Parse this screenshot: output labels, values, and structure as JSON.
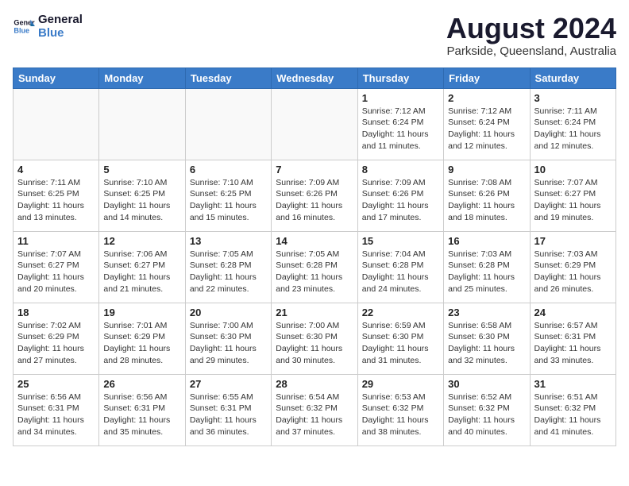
{
  "header": {
    "logo_line1": "General",
    "logo_line2": "Blue",
    "main_title": "August 2024",
    "subtitle": "Parkside, Queensland, Australia"
  },
  "weekdays": [
    "Sunday",
    "Monday",
    "Tuesday",
    "Wednesday",
    "Thursday",
    "Friday",
    "Saturday"
  ],
  "weeks": [
    [
      {
        "day": "",
        "info": ""
      },
      {
        "day": "",
        "info": ""
      },
      {
        "day": "",
        "info": ""
      },
      {
        "day": "",
        "info": ""
      },
      {
        "day": "1",
        "info": "Sunrise: 7:12 AM\nSunset: 6:24 PM\nDaylight: 11 hours\nand 11 minutes."
      },
      {
        "day": "2",
        "info": "Sunrise: 7:12 AM\nSunset: 6:24 PM\nDaylight: 11 hours\nand 12 minutes."
      },
      {
        "day": "3",
        "info": "Sunrise: 7:11 AM\nSunset: 6:24 PM\nDaylight: 11 hours\nand 12 minutes."
      }
    ],
    [
      {
        "day": "4",
        "info": "Sunrise: 7:11 AM\nSunset: 6:25 PM\nDaylight: 11 hours\nand 13 minutes."
      },
      {
        "day": "5",
        "info": "Sunrise: 7:10 AM\nSunset: 6:25 PM\nDaylight: 11 hours\nand 14 minutes."
      },
      {
        "day": "6",
        "info": "Sunrise: 7:10 AM\nSunset: 6:25 PM\nDaylight: 11 hours\nand 15 minutes."
      },
      {
        "day": "7",
        "info": "Sunrise: 7:09 AM\nSunset: 6:26 PM\nDaylight: 11 hours\nand 16 minutes."
      },
      {
        "day": "8",
        "info": "Sunrise: 7:09 AM\nSunset: 6:26 PM\nDaylight: 11 hours\nand 17 minutes."
      },
      {
        "day": "9",
        "info": "Sunrise: 7:08 AM\nSunset: 6:26 PM\nDaylight: 11 hours\nand 18 minutes."
      },
      {
        "day": "10",
        "info": "Sunrise: 7:07 AM\nSunset: 6:27 PM\nDaylight: 11 hours\nand 19 minutes."
      }
    ],
    [
      {
        "day": "11",
        "info": "Sunrise: 7:07 AM\nSunset: 6:27 PM\nDaylight: 11 hours\nand 20 minutes."
      },
      {
        "day": "12",
        "info": "Sunrise: 7:06 AM\nSunset: 6:27 PM\nDaylight: 11 hours\nand 21 minutes."
      },
      {
        "day": "13",
        "info": "Sunrise: 7:05 AM\nSunset: 6:28 PM\nDaylight: 11 hours\nand 22 minutes."
      },
      {
        "day": "14",
        "info": "Sunrise: 7:05 AM\nSunset: 6:28 PM\nDaylight: 11 hours\nand 23 minutes."
      },
      {
        "day": "15",
        "info": "Sunrise: 7:04 AM\nSunset: 6:28 PM\nDaylight: 11 hours\nand 24 minutes."
      },
      {
        "day": "16",
        "info": "Sunrise: 7:03 AM\nSunset: 6:28 PM\nDaylight: 11 hours\nand 25 minutes."
      },
      {
        "day": "17",
        "info": "Sunrise: 7:03 AM\nSunset: 6:29 PM\nDaylight: 11 hours\nand 26 minutes."
      }
    ],
    [
      {
        "day": "18",
        "info": "Sunrise: 7:02 AM\nSunset: 6:29 PM\nDaylight: 11 hours\nand 27 minutes."
      },
      {
        "day": "19",
        "info": "Sunrise: 7:01 AM\nSunset: 6:29 PM\nDaylight: 11 hours\nand 28 minutes."
      },
      {
        "day": "20",
        "info": "Sunrise: 7:00 AM\nSunset: 6:30 PM\nDaylight: 11 hours\nand 29 minutes."
      },
      {
        "day": "21",
        "info": "Sunrise: 7:00 AM\nSunset: 6:30 PM\nDaylight: 11 hours\nand 30 minutes."
      },
      {
        "day": "22",
        "info": "Sunrise: 6:59 AM\nSunset: 6:30 PM\nDaylight: 11 hours\nand 31 minutes."
      },
      {
        "day": "23",
        "info": "Sunrise: 6:58 AM\nSunset: 6:30 PM\nDaylight: 11 hours\nand 32 minutes."
      },
      {
        "day": "24",
        "info": "Sunrise: 6:57 AM\nSunset: 6:31 PM\nDaylight: 11 hours\nand 33 minutes."
      }
    ],
    [
      {
        "day": "25",
        "info": "Sunrise: 6:56 AM\nSunset: 6:31 PM\nDaylight: 11 hours\nand 34 minutes."
      },
      {
        "day": "26",
        "info": "Sunrise: 6:56 AM\nSunset: 6:31 PM\nDaylight: 11 hours\nand 35 minutes."
      },
      {
        "day": "27",
        "info": "Sunrise: 6:55 AM\nSunset: 6:31 PM\nDaylight: 11 hours\nand 36 minutes."
      },
      {
        "day": "28",
        "info": "Sunrise: 6:54 AM\nSunset: 6:32 PM\nDaylight: 11 hours\nand 37 minutes."
      },
      {
        "day": "29",
        "info": "Sunrise: 6:53 AM\nSunset: 6:32 PM\nDaylight: 11 hours\nand 38 minutes."
      },
      {
        "day": "30",
        "info": "Sunrise: 6:52 AM\nSunset: 6:32 PM\nDaylight: 11 hours\nand 40 minutes."
      },
      {
        "day": "31",
        "info": "Sunrise: 6:51 AM\nSunset: 6:32 PM\nDaylight: 11 hours\nand 41 minutes."
      }
    ]
  ]
}
